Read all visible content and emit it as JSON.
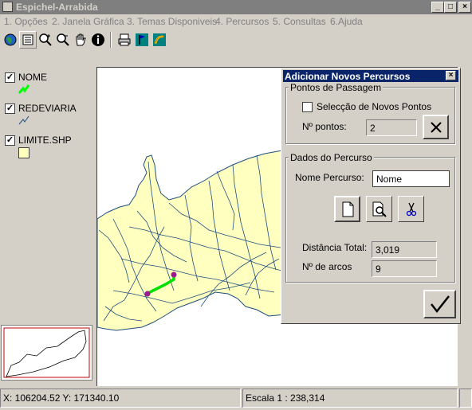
{
  "window": {
    "title": "Espichel-Arrabida",
    "minimize": "_",
    "maximize": "□",
    "close": "×"
  },
  "menu": [
    {
      "label": "1. Opções"
    },
    {
      "label": "2. Janela Gráfica"
    },
    {
      "label": "3. Temas Disponiveis"
    },
    {
      "label": "4. Percursos"
    },
    {
      "label": "5. Consultas"
    },
    {
      "label": "6.Ajuda"
    }
  ],
  "toolbar": {
    "icons": [
      "globe-icon",
      "legend-icon",
      "zoom-in-icon",
      "zoom-out-icon",
      "pan-hand-icon",
      "info-icon",
      "print-icon",
      "flag-icon",
      "route-icon"
    ]
  },
  "legend": {
    "layers": [
      {
        "name": "NOME",
        "checked": true,
        "symbol_color": "#00ff00"
      },
      {
        "name": "REDEVIARIA",
        "checked": true,
        "symbol_color": "#1f4f7f"
      },
      {
        "name": "LIMITE.SHP",
        "checked": true,
        "symbol_color": "#ffffc0"
      }
    ]
  },
  "colors": {
    "land_fill": "#ffffc0",
    "road_color": "#1f4f7f",
    "route_color": "#00e000",
    "waypoint_color": "#9d1a8e",
    "dialog_title": "#0a246a"
  },
  "status": {
    "coords": "X: 106204.52 Y: 171340.10",
    "scale": "Escala 1 : 238,314"
  },
  "dialog": {
    "title": "Adicionar Novos Percursos",
    "close": "×",
    "group1_label": "Pontos de Passagem",
    "new_points_label": "Selecção de Novos Pontos",
    "new_points_checked": false,
    "n_points_label": "Nº pontos:",
    "n_points_value": "2",
    "group2_label": "Dados do Percurso",
    "route_name_label": "Nome Percurso:",
    "route_name_value": "Nome",
    "total_distance_label": "Distância Total:",
    "total_distance_value": "3,019",
    "n_arcs_label": "Nº de arcos",
    "n_arcs_value": "9",
    "ok_symbol": "✓"
  }
}
